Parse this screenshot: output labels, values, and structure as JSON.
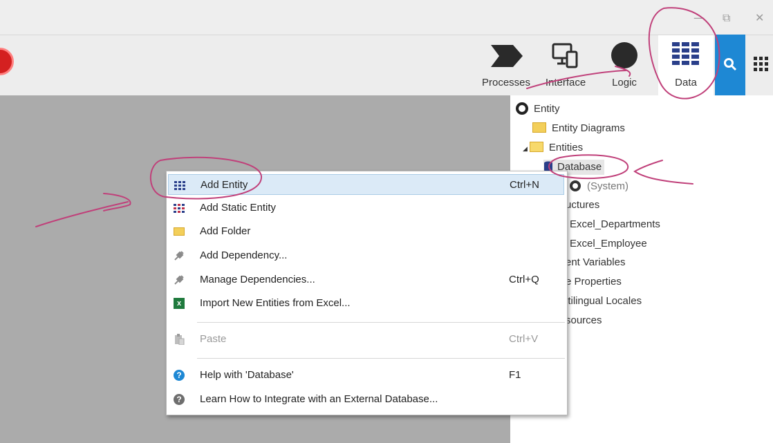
{
  "window": {
    "controls": {
      "minimize": "—",
      "restore": "⧉",
      "close": "✕"
    }
  },
  "toolbar": {
    "tabs": [
      {
        "label": "Processes",
        "icon": "processes-chevron-icon"
      },
      {
        "label": "Interface",
        "icon": "interface-devices-icon"
      },
      {
        "label": "Logic",
        "icon": "logic-circle-icon"
      },
      {
        "label": "Data",
        "icon": "data-grid-icon",
        "active": true
      }
    ],
    "accent": "#1e88d4"
  },
  "tree": {
    "items": [
      {
        "label": "Entity",
        "icon": "entity-circle-icon"
      },
      {
        "label": "Entity Diagrams",
        "icon": "folder-icon"
      },
      {
        "label": "Entities",
        "icon": "open-folder-icon"
      },
      {
        "label": "Database",
        "icon": "database-icon"
      },
      {
        "label": "(System)",
        "icon": "entity-circle-icon"
      },
      {
        "label": "uctures"
      },
      {
        "label": "Excel_Departments"
      },
      {
        "label": "Excel_Employee"
      },
      {
        "label": "ent Variables"
      },
      {
        "label": "e Properties"
      },
      {
        "label": "ltilingual Locales"
      },
      {
        "label": "sources"
      }
    ]
  },
  "context_menu": {
    "items": [
      {
        "label": "Add Entity",
        "shortcut": "Ctrl+N",
        "icon": "entity-grid-icon",
        "highlighted": true
      },
      {
        "label": "Add Static Entity",
        "shortcut": "",
        "icon": "static-entity-grid-icon"
      },
      {
        "label": "Add Folder",
        "shortcut": "",
        "icon": "folder-icon"
      },
      {
        "label": "Add Dependency...",
        "shortcut": "",
        "icon": "plug-icon"
      },
      {
        "label": "Manage Dependencies...",
        "shortcut": "Ctrl+Q",
        "icon": "plug-icon"
      },
      {
        "label": "Import New Entities from Excel...",
        "shortcut": "",
        "icon": "excel-icon"
      },
      {
        "label": "Paste",
        "shortcut": "Ctrl+V",
        "icon": "paste-icon",
        "disabled": true
      },
      {
        "label": "Help with 'Database'",
        "shortcut": "F1",
        "icon": "help-icon"
      },
      {
        "label": "Learn How to Integrate with an External Database...",
        "shortcut": "",
        "icon": "help-dark-icon"
      }
    ]
  },
  "annotation_color": "#c0407a"
}
